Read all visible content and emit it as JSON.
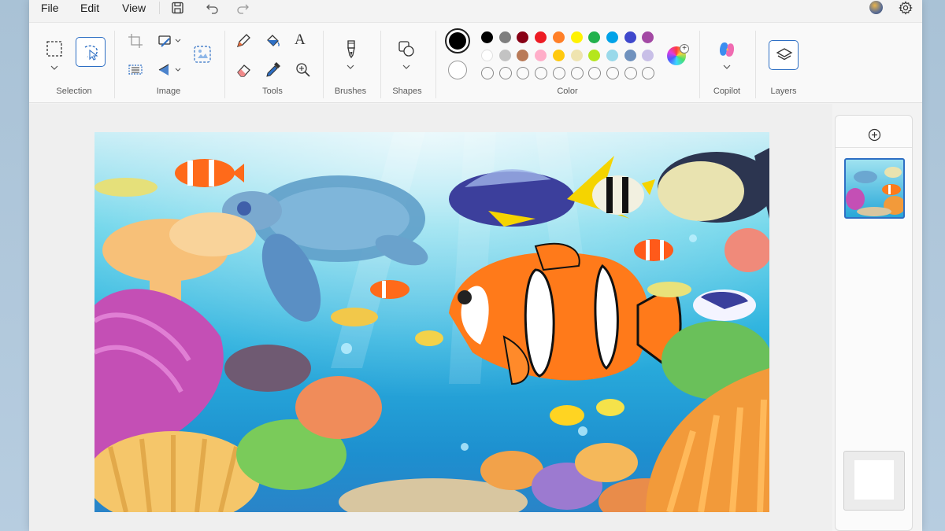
{
  "menu": {
    "file": "File",
    "edit": "Edit",
    "view": "View"
  },
  "quick_access": {
    "icons": [
      "save-icon",
      "undo-icon",
      "redo-icon"
    ]
  },
  "ribbon": {
    "groups": {
      "selection": "Selection",
      "image": "Image",
      "tools": "Tools",
      "brushes": "Brushes",
      "shapes": "Shapes",
      "color": "Color",
      "copilot": "Copilot",
      "layers": "Layers"
    }
  },
  "colors": {
    "primary": "#000000",
    "secondary": "#ffffff",
    "row1": [
      "#000000",
      "#7f7f7f",
      "#880015",
      "#ed1c24",
      "#ff7f27",
      "#fff200",
      "#22b14c",
      "#00a2e8",
      "#3f48cc",
      "#a349a4"
    ],
    "row2": [
      "#ffffff",
      "#c3c3c3",
      "#b97a57",
      "#ffaec9",
      "#ffc90e",
      "#efe4b0",
      "#b5e61d",
      "#99d9ea",
      "#7092be",
      "#c8bfe7"
    ],
    "custom_slots": 10,
    "accent": "#2e6fc4"
  },
  "layers": {
    "add_icon": "add-layer-icon"
  }
}
